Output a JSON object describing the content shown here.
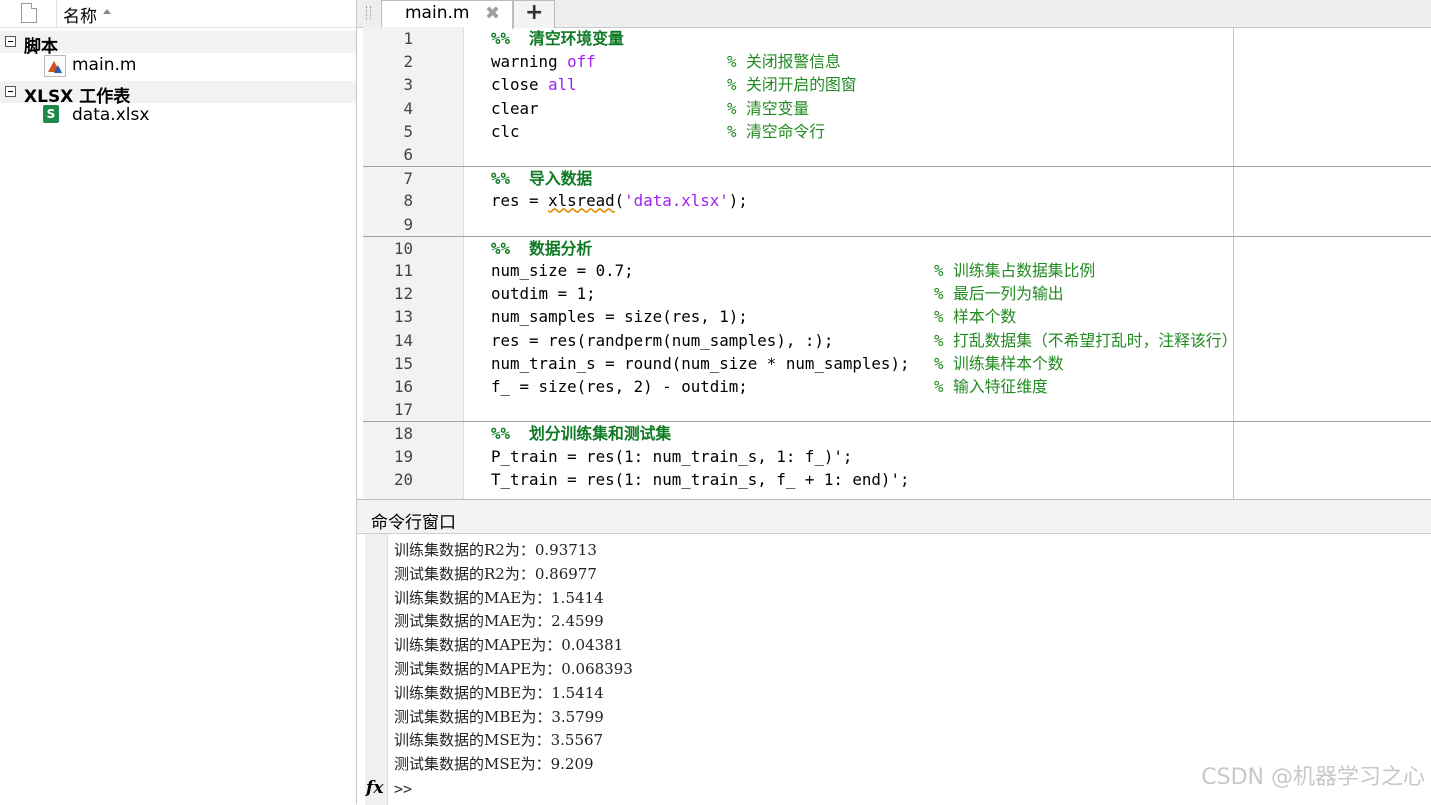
{
  "file_panel": {
    "header": {
      "name_col": "名称"
    },
    "groups": [
      {
        "label": "脚本",
        "files": [
          {
            "name": "main.m",
            "icon": "matlab-file-icon"
          }
        ]
      },
      {
        "label": "XLSX 工作表",
        "files": [
          {
            "name": "data.xlsx",
            "icon": "spreadsheet-icon",
            "badge": "S"
          }
        ]
      }
    ]
  },
  "editor": {
    "tab": {
      "label": "main.m"
    },
    "lines": [
      {
        "n": "1",
        "section": true,
        "code": "%%  清空环境变量",
        "comment": ""
      },
      {
        "n": "2",
        "section": false,
        "code": "warning off",
        "comment": "% 关闭报警信息"
      },
      {
        "n": "3",
        "section": false,
        "code": "close all",
        "comment": "% 关闭开启的图窗"
      },
      {
        "n": "4",
        "section": false,
        "code": "clear",
        "comment": "% 清空变量"
      },
      {
        "n": "5",
        "section": false,
        "code": "clc",
        "comment": "% 清空命令行"
      },
      {
        "n": "6",
        "section": false,
        "code": "",
        "comment": ""
      },
      {
        "n": "7",
        "section": true,
        "code": "%%  导入数据",
        "comment": ""
      },
      {
        "n": "8",
        "section": false,
        "code": "res = xlsread('data.xlsx');",
        "comment": ""
      },
      {
        "n": "9",
        "section": false,
        "code": "",
        "comment": ""
      },
      {
        "n": "10",
        "section": true,
        "code": "%%  数据分析",
        "comment": ""
      },
      {
        "n": "11",
        "section": false,
        "code": "num_size = 0.7;",
        "comment": "% 训练集占数据集比例"
      },
      {
        "n": "12",
        "section": false,
        "code": "outdim = 1;",
        "comment": "% 最后一列为输出"
      },
      {
        "n": "13",
        "section": false,
        "code": "num_samples = size(res, 1);",
        "comment": "% 样本个数"
      },
      {
        "n": "14",
        "section": false,
        "code": "res = res(randperm(num_samples), :);",
        "comment": "% 打乱数据集（不希望打乱时，注释该行）"
      },
      {
        "n": "15",
        "section": false,
        "code": "num_train_s = round(num_size * num_samples);",
        "comment": "% 训练集样本个数"
      },
      {
        "n": "16",
        "section": false,
        "code": "f_ = size(res, 2) - outdim;",
        "comment": "% 输入特征维度"
      },
      {
        "n": "17",
        "section": false,
        "code": "",
        "comment": ""
      },
      {
        "n": "18",
        "section": true,
        "code": "%%  划分训练集和测试集",
        "comment": ""
      },
      {
        "n": "19",
        "section": false,
        "code": "P_train = res(1: num_train_s, 1: f_)';",
        "comment": ""
      },
      {
        "n": "20",
        "section": false,
        "code": "T_train = res(1: num_train_s, f_ + 1: end)';",
        "comment": ""
      }
    ]
  },
  "command_window": {
    "title": "命令行窗口",
    "output": [
      "训练集数据的R2为：0.93713",
      "测试集数据的R2为：0.86977",
      "训练集数据的MAE为：1.5414",
      "测试集数据的MAE为：2.4599",
      "训练集数据的MAPE为：0.04381",
      "测试集数据的MAPE为：0.068393",
      "训练集数据的MBE为：1.5414",
      "测试集数据的MBE为：3.5799",
      "训练集数据的MSE为：3.5567",
      "测试集数据的MSE为：9.209"
    ],
    "prompt": ">>",
    "fx": "fx"
  },
  "watermark": "CSDN @机器学习之心"
}
